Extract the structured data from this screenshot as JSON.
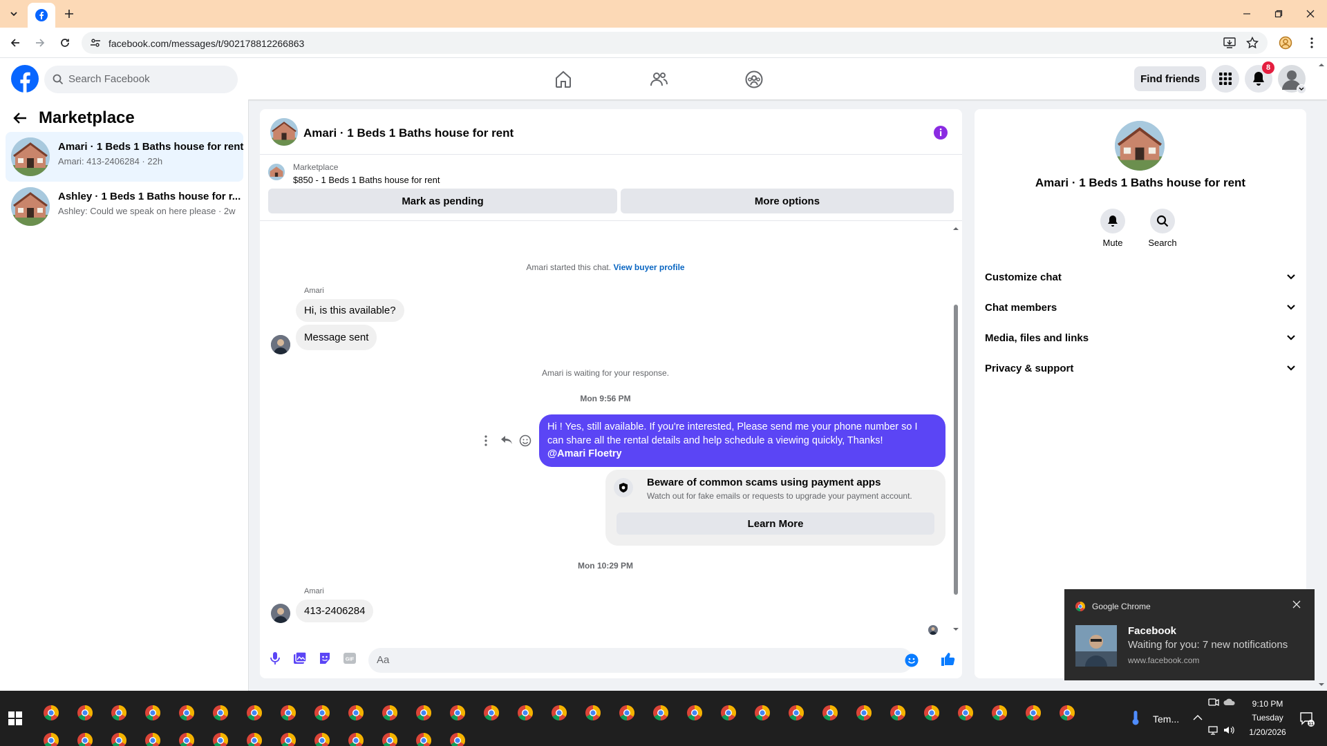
{
  "browser": {
    "url": "facebook.com/messages/t/902178812266863"
  },
  "header": {
    "search_placeholder": "Search Facebook",
    "find_friends": "Find friends",
    "notification_count": "8"
  },
  "left_panel": {
    "title": "Marketplace",
    "conversations": [
      {
        "title": "Amari · 1 Beds 1 Baths house for rent",
        "subtitle": "Amari: 413-2406284 · 22h",
        "selected": true
      },
      {
        "title": "Ashley · 1 Beds 1 Baths house for r...",
        "subtitle": "Ashley: Could we speak on here please · 2w",
        "selected": false
      }
    ]
  },
  "chat": {
    "title": "Amari · 1 Beds 1 Baths house for rent",
    "listing_source": "Marketplace",
    "listing_title": "$850 - 1 Beds 1 Baths house for rent",
    "mark_pending": "Mark as pending",
    "more_options": "More options",
    "started_text": "Amari started this chat.",
    "buyer_profile_link": "View buyer profile",
    "sender_name": "Amari",
    "msg1": "Hi, is this available?",
    "msg2": "Message sent",
    "waiting_text": "Amari is waiting for your response.",
    "time1": "Mon 9:56 PM",
    "my_msg_line1": "Hi ! Yes, still available. If you're interested, Please send me your phone number so I",
    "my_msg_line2": "can share all the rental details and help schedule a viewing quickly, Thanks!",
    "my_msg_mention": "@Amari Floetry",
    "scam_title": "Beware of common scams using payment apps",
    "scam_text": "Watch out for fake emails or requests to upgrade your payment account.",
    "learn_more": "Learn More",
    "time2": "Mon 10:29 PM",
    "sender_name2": "Amari",
    "msg3": "413-2406284",
    "composer_placeholder": "Aa"
  },
  "right_panel": {
    "title": "Amari · 1 Beds 1 Baths house for rent",
    "mute": "Mute",
    "search": "Search",
    "sections": [
      "Customize chat",
      "Chat members",
      "Media, files and links",
      "Privacy & support"
    ]
  },
  "toast": {
    "app": "Google Chrome",
    "title": "Facebook",
    "body": "Waiting for you: 7 new notifications",
    "source": "www.facebook.com"
  },
  "taskbar": {
    "weather": "Tem...",
    "time": "9:10 PM",
    "day": "Tuesday",
    "date": "1/20/2026"
  },
  "colors": {
    "facebook_blue": "#0866ff",
    "my_bubble": "#5b45f5",
    "link": "#0a66c2",
    "tab_strip": "#fcd9b6"
  }
}
